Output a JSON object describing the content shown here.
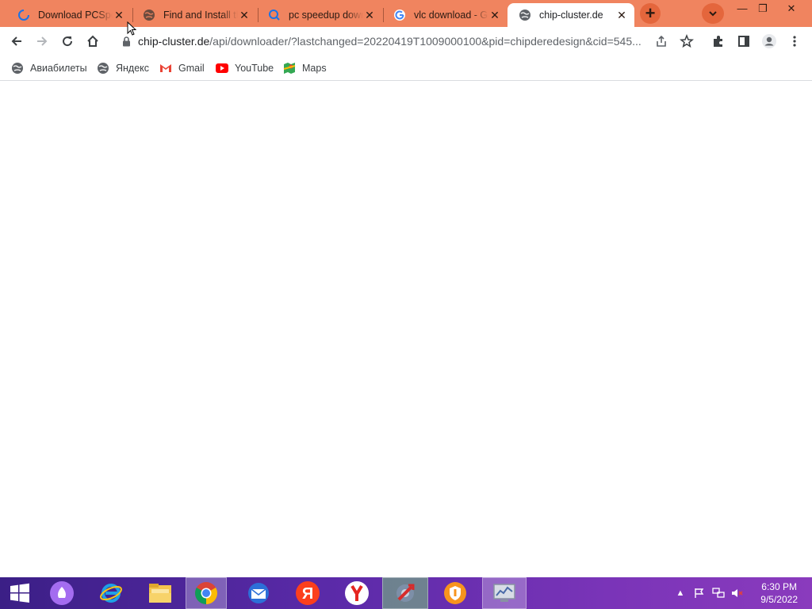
{
  "tabs": [
    {
      "title": "Download PCSpeedup",
      "favicon": "loading-spinner-icon",
      "active": false
    },
    {
      "title": "Find and Install the",
      "favicon": "globe-icon",
      "active": false
    },
    {
      "title": "pc speedup download",
      "favicon": "search-icon",
      "active": false
    },
    {
      "title": "vlc download - Google",
      "favicon": "google-icon",
      "active": false
    },
    {
      "title": "chip-cluster.de",
      "favicon": "globe-icon",
      "active": true
    }
  ],
  "toolbar": {
    "url_host": "chip-cluster.de",
    "url_path": "/api/downloader/?lastchanged=20220419T1009000100&pid=chipderedesign&cid=545..."
  },
  "bookmarks": [
    {
      "label": "Авиабилеты",
      "icon": "globe-icon"
    },
    {
      "label": "Яндекс",
      "icon": "globe-icon"
    },
    {
      "label": "Gmail",
      "icon": "gmail-icon"
    },
    {
      "label": "YouTube",
      "icon": "youtube-icon"
    },
    {
      "label": "Maps",
      "icon": "maps-icon"
    }
  ],
  "taskbar": {
    "apps": [
      "start-icon",
      "alice-assistant-icon",
      "internet-explorer-icon",
      "file-explorer-icon",
      "chrome-icon",
      "mail-icon",
      "yandex-icon",
      "yandex-browser-icon",
      "system-tool-icon",
      "avast-icon",
      "monitor-app-icon"
    ],
    "clock_time": "6:30 PM",
    "clock_date": "9/5/2022"
  },
  "colors": {
    "tabstrip": "#f0845f",
    "taskbar": "#5a2aa8"
  }
}
